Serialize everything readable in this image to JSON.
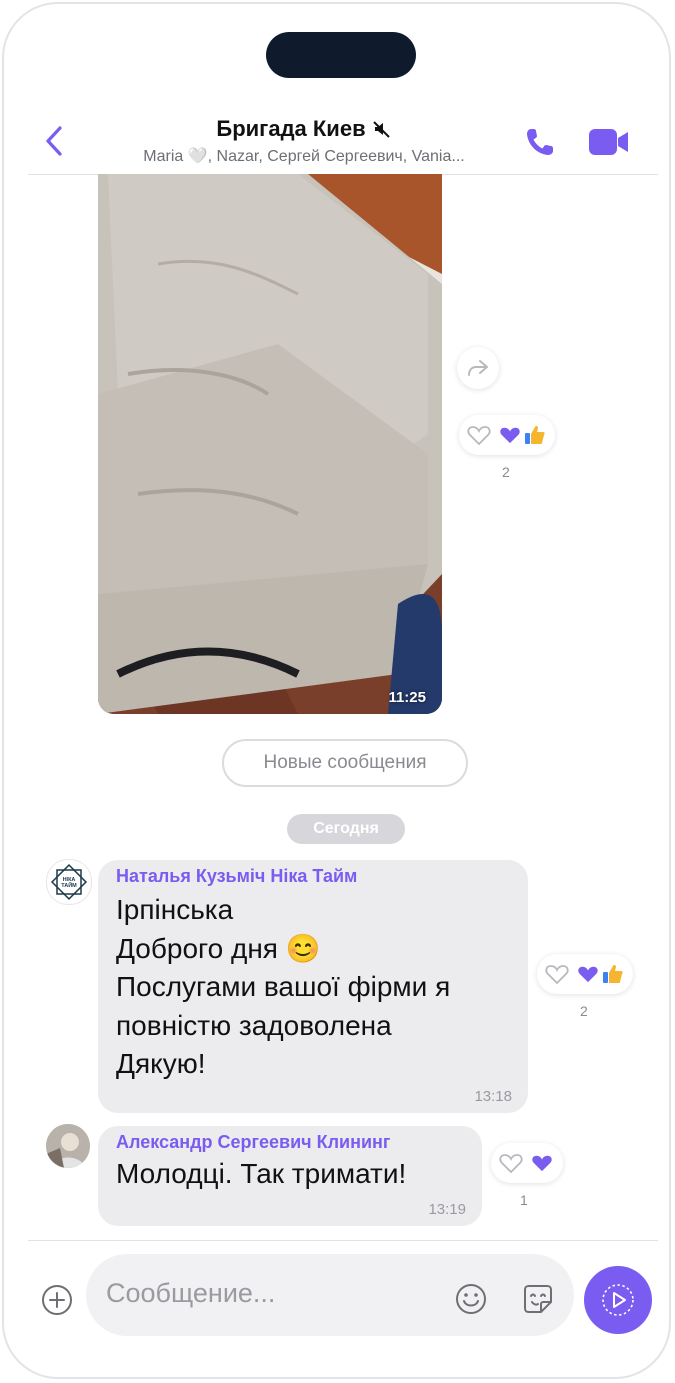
{
  "header": {
    "title": "Бригада Киев",
    "subtitle": "Maria 🤍, Nazar, Сергей Сергеевич, Vania..."
  },
  "media_message": {
    "time": "11:25",
    "reactions": {
      "count": "2",
      "emoji": [
        "purple-heart",
        "thumbs-up"
      ]
    }
  },
  "new_messages_label": "Новые сообщения",
  "date_separator": "Сегодня",
  "messages": [
    {
      "sender": "Наталья Кузьміч Ніка Тайм",
      "avatar_text": "НІКА ТАЙМ",
      "lines": [
        "Ірпінська",
        "Доброго дня 😊",
        "Послугами вашої фірми я",
        "повністю задоволена",
        "Дякую!"
      ],
      "time": "13:18",
      "reactions": {
        "count": "2",
        "emoji": [
          "purple-heart",
          "thumbs-up"
        ]
      }
    },
    {
      "sender": "Александр Сергеевич Клининг",
      "lines": [
        "Молодці. Так тримати!"
      ],
      "time": "13:19",
      "reactions": {
        "count": "1",
        "emoji": [
          "purple-heart"
        ]
      }
    }
  ],
  "composer": {
    "placeholder": "Сообщение..."
  },
  "colors": {
    "accent": "#7b5cf0",
    "bubble": "#ececef"
  }
}
